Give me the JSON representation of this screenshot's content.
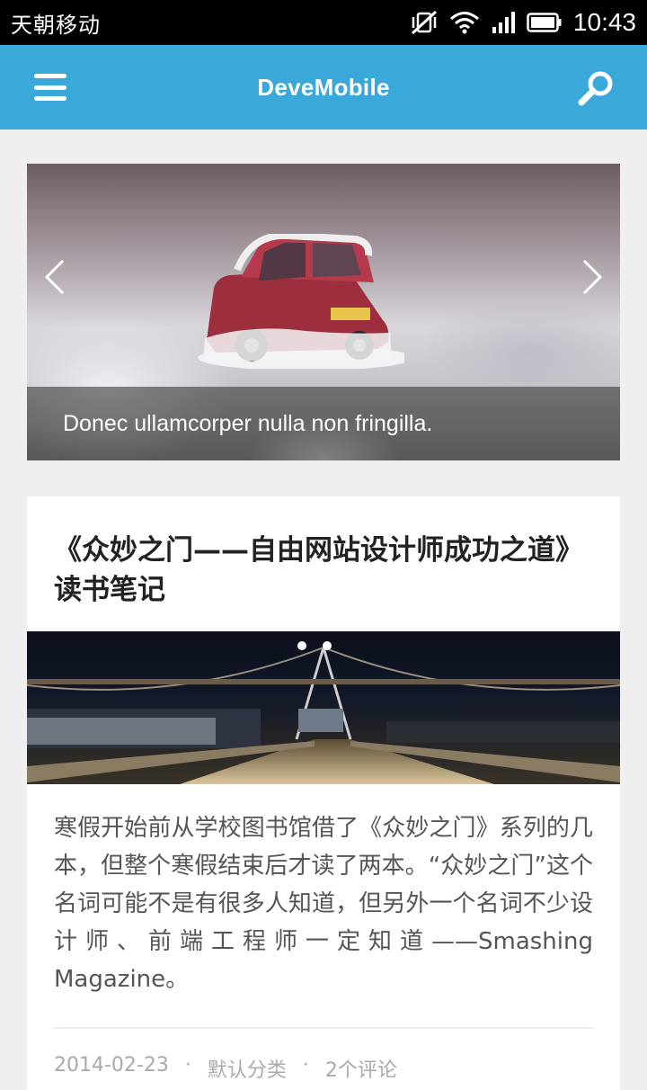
{
  "status_bar": {
    "carrier": "天朝移动",
    "time": "10:43",
    "icons": [
      "mute-vibrate-icon",
      "wifi-icon",
      "signal-icon",
      "battery-icon"
    ]
  },
  "app_bar": {
    "title": "DeveMobile",
    "menu_icon": "hamburger-menu-icon",
    "search_icon": "search-icon",
    "background": "#3aa8d8"
  },
  "slider": {
    "caption": "Donec ullamcorper nulla non fringilla.",
    "prev_icon": "chevron-left-icon",
    "next_icon": "chevron-right-icon"
  },
  "post": {
    "title": "《众妙之门——自由网站设计师成功之道》读书笔记",
    "excerpt": "寒假开始前从学校图书馆借了《众妙之门》系列的几本，但整个寒假结束后才读了两本。“众妙之门”这个名词可能不是有很多人知道，但另外一个名词不少设计师、前端工程师一定知道——Smashing Magazine。",
    "date": "2014-02-23",
    "category": "默认分类",
    "comments": "2个评论",
    "separator": "·"
  }
}
